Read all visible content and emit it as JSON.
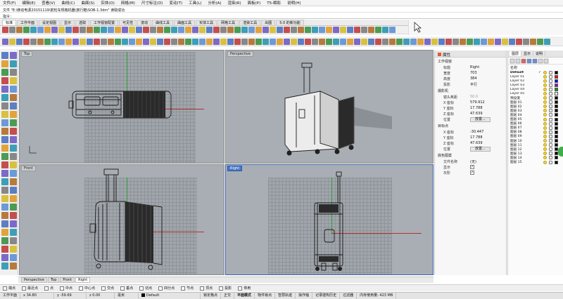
{
  "menu": [
    "文件(F)",
    "编辑(E)",
    "查看(V)",
    "曲线(C)",
    "曲面(S)",
    "实体(O)",
    "网格(M)",
    "尺寸标注(D)",
    "变动(T)",
    "工具(L)",
    "分析(A)",
    "渲染(R)",
    "面板(P)",
    "T5-瞬影",
    "说明(H)"
  ],
  "command_history": "文件 \"E:\\移动电源20151119\\箭轮车规格机器\\旅行箱\\SOB-1.3dm\" 读取成功",
  "command_prompt": "指令：",
  "toolbar_tabs": [
    {
      "label": "标准",
      "active": true
    },
    {
      "label": "工作平面",
      "active": false
    },
    {
      "label": "设定视图",
      "active": false
    },
    {
      "label": "显示",
      "active": false
    },
    {
      "label": "选取",
      "active": false
    },
    {
      "label": "工作视窗配置",
      "active": false
    },
    {
      "label": "可见性",
      "active": false
    },
    {
      "label": "变动",
      "active": false
    },
    {
      "label": "曲线工具",
      "active": false
    },
    {
      "label": "曲面工具",
      "active": false
    },
    {
      "label": "实体工具",
      "active": false
    },
    {
      "label": "网格工具",
      "active": false
    },
    {
      "label": "渲染工具",
      "active": false
    },
    {
      "label": "出图",
      "active": false
    },
    {
      "label": "5.0 的新功能",
      "active": false
    }
  ],
  "viewports": {
    "top": {
      "title": "Top"
    },
    "perspective": {
      "title": "Perspective"
    },
    "front": {
      "title": "Front"
    },
    "right": {
      "title": "Right"
    }
  },
  "viewport_tabs": [
    {
      "label": "Perspective",
      "active": false
    },
    {
      "label": "Top",
      "active": false
    },
    {
      "label": "Front",
      "active": false
    },
    {
      "label": "Right",
      "active": true
    }
  ],
  "properties": {
    "header": "属性",
    "sections": {
      "viewport": "工作视窗",
      "camera": "摄影机",
      "target": "目标点",
      "wallpaper": "底色图案"
    },
    "viewport_rows": [
      {
        "label": "标题",
        "value": "Right"
      },
      {
        "label": "宽度",
        "value": "703"
      },
      {
        "label": "高度",
        "value": "384"
      },
      {
        "label": "投影",
        "value": "平行"
      }
    ],
    "camera_rows": [
      {
        "label": "镜头焦距",
        "value": "50.0"
      },
      {
        "label": "X 座标",
        "value": "579.912"
      },
      {
        "label": "Y 座标",
        "value": "17.788"
      },
      {
        "label": "Z 座标",
        "value": "47.639"
      }
    ],
    "target_rows": [
      {
        "label": "X 座标",
        "value": "-30.447"
      },
      {
        "label": "Y 座标",
        "value": "17.788"
      },
      {
        "label": "Z 座标",
        "value": "47.639"
      }
    ],
    "position_label": "位置",
    "place_button": "放置...",
    "wallpaper_rows": [
      {
        "label": "文件名称",
        "value": "(无)"
      },
      {
        "label": "显示",
        "value": "✓"
      },
      {
        "label": "灰阶",
        "value": "✓"
      }
    ]
  },
  "layers": {
    "tabs": [
      "图层",
      "显示",
      "说明"
    ],
    "column_header": "名称",
    "rows": [
      {
        "name": "Default",
        "current": "✓",
        "color": "#000000"
      },
      {
        "name": "Layer 01",
        "current": "",
        "color": "#ff0000"
      },
      {
        "name": "Layer 02",
        "current": "",
        "color": "#0000ff"
      },
      {
        "name": "Layer 03",
        "current": "",
        "color": "#b400b4"
      },
      {
        "name": "Layer 04",
        "current": "",
        "color": "#00a000"
      },
      {
        "name": "Layer 05",
        "current": "",
        "color": "#ffffff"
      },
      {
        "name": "预设值",
        "current": "",
        "color": "#000000"
      },
      {
        "name": "图层 01",
        "current": "",
        "color": "#000000"
      },
      {
        "name": "图层 02",
        "current": "",
        "color": "#000000"
      },
      {
        "name": "图层 03",
        "current": "",
        "color": "#000000"
      },
      {
        "name": "图层 04",
        "current": "",
        "color": "#000000"
      },
      {
        "name": "图层 05",
        "current": "",
        "color": "#000000"
      },
      {
        "name": "图层 06",
        "current": "",
        "color": "#000000"
      },
      {
        "name": "图层 07",
        "current": "",
        "color": "#000000"
      },
      {
        "name": "图层 08",
        "current": "",
        "color": "#000000"
      },
      {
        "name": "图层 09",
        "current": "",
        "color": "#000000"
      },
      {
        "name": "图层 10",
        "current": "",
        "color": "#000000"
      },
      {
        "name": "图层 11",
        "current": "",
        "color": "#000000"
      },
      {
        "name": "图层 12",
        "current": "",
        "color": "#000000"
      },
      {
        "name": "图层 13",
        "current": "",
        "color": "#000000"
      },
      {
        "name": "图层 14",
        "current": "",
        "color": "#000000"
      },
      {
        "name": "图层 15",
        "current": "",
        "color": "#000000"
      }
    ]
  },
  "osnap": [
    "端点",
    "最近点",
    "点",
    "中点",
    "中心点",
    "交点",
    "垂点",
    "切点",
    "四分点",
    "节点",
    "顶点",
    "投影",
    "停用"
  ],
  "status": {
    "plane": "工作平面",
    "x": "x 34.80",
    "y": "y -59.69",
    "z": "z 0.00",
    "unit": "毫米",
    "layer": "Default",
    "toggles": [
      "锁定格点",
      "正交",
      "平面模式",
      "物件锁点",
      "智慧轨迹",
      "操作轴",
      "记录建构历史",
      "过滤器"
    ],
    "memory": "内存使用量: 423 MB"
  }
}
